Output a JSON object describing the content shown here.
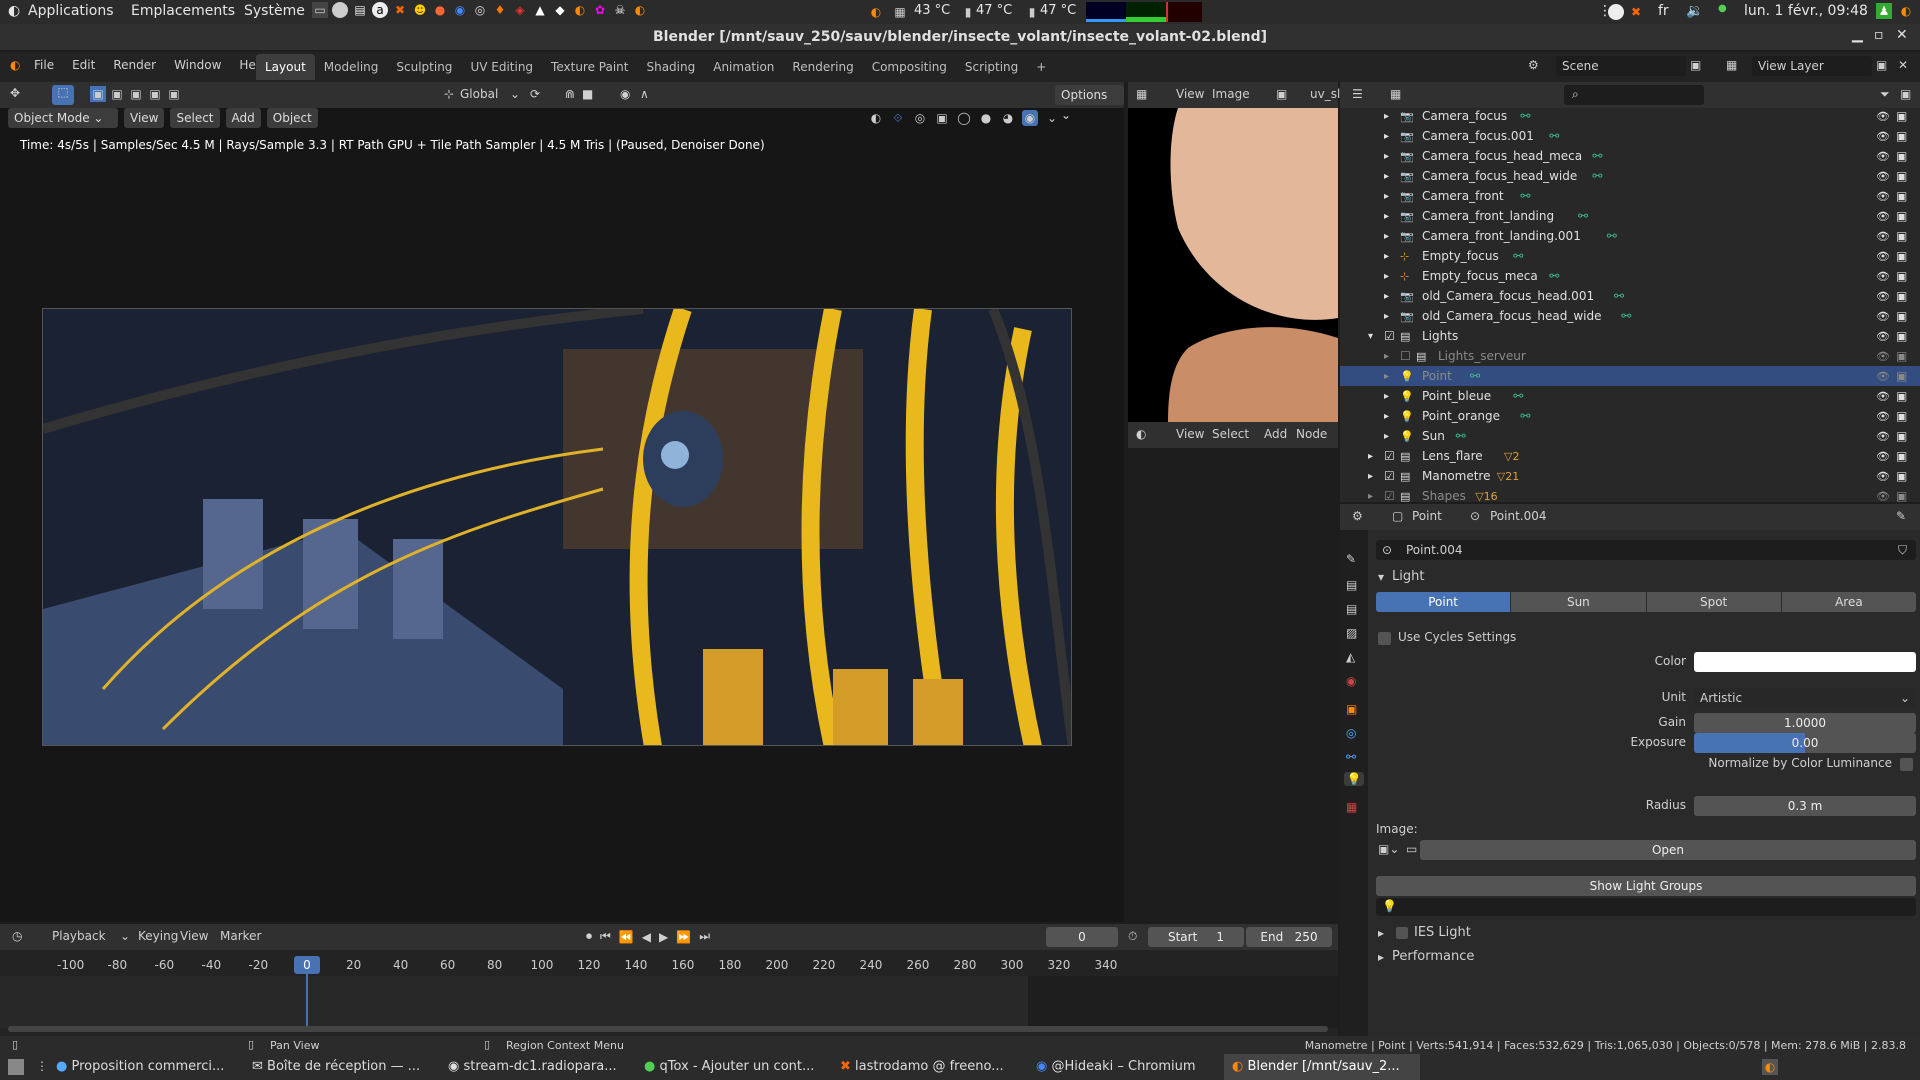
{
  "os_bar": {
    "apps": "Applications",
    "places": "Emplacements",
    "system": "Système",
    "temps": [
      "43 °C",
      "47 °C",
      "47 °C"
    ],
    "lang": "fr",
    "datetime": "lun. 1 févr., 09:48"
  },
  "window": {
    "title": "Blender [/mnt/sauv_250/sauv/blender/insecte_volant/insecte_volant-02.blend]"
  },
  "menu": [
    "File",
    "Edit",
    "Render",
    "Window",
    "Help"
  ],
  "workspaces": [
    "Layout",
    "Modeling",
    "Sculpting",
    "UV Editing",
    "Texture Paint",
    "Shading",
    "Animation",
    "Rendering",
    "Compositing",
    "Scripting"
  ],
  "scene": {
    "name": "Scene",
    "view_layer": "View Layer"
  },
  "viewport": {
    "transform": "Global",
    "options": "Options",
    "mode": "Object Mode",
    "menus": [
      "View",
      "Select",
      "Add",
      "Object"
    ],
    "status": "Time: 4s/5s | Samples/Sec 4.5 M | Rays/Sample 3.3 | RT Path GPU + Tile Path Sampler | 4.5 M Tris | (Paused, Denoiser Done)"
  },
  "image_editor": {
    "menus": [
      "View",
      "Image"
    ],
    "slot": "uv_sl"
  },
  "node_editor": {
    "menus": [
      "View",
      "Select",
      "Add",
      "Node"
    ]
  },
  "outliner": {
    "search_placeholder": "",
    "items": [
      {
        "label": "Camera_focus",
        "type": "camera",
        "indent": 1
      },
      {
        "label": "Camera_focus.001",
        "type": "camera",
        "indent": 1
      },
      {
        "label": "Camera_focus_head_meca",
        "type": "camera",
        "indent": 1
      },
      {
        "label": "Camera_focus_head_wide",
        "type": "camera",
        "indent": 1
      },
      {
        "label": "Camera_front",
        "type": "camera",
        "indent": 1
      },
      {
        "label": "Camera_front_landing",
        "type": "camera",
        "indent": 1
      },
      {
        "label": "Camera_front_landing.001",
        "type": "camera",
        "indent": 1
      },
      {
        "label": "Empty_focus",
        "type": "empty",
        "indent": 1
      },
      {
        "label": "Empty_focus_meca",
        "type": "empty",
        "indent": 1
      },
      {
        "label": "old_Camera_focus_head.001",
        "type": "camera",
        "indent": 1
      },
      {
        "label": "old_Camera_focus_head_wide",
        "type": "camera",
        "indent": 1
      },
      {
        "label": "Lights",
        "type": "collection",
        "indent": 0
      },
      {
        "label": "Lights_serveur",
        "type": "collection",
        "indent": 1
      },
      {
        "label": "Point",
        "type": "light",
        "indent": 1
      },
      {
        "label": "Point_bleue",
        "type": "light",
        "indent": 1
      },
      {
        "label": "Point_orange",
        "type": "light",
        "indent": 1
      },
      {
        "label": "Sun",
        "type": "light",
        "indent": 1
      },
      {
        "label": "Lens_flare",
        "type": "collection",
        "indent": 0
      },
      {
        "label": "Manometre",
        "type": "collection",
        "indent": 0
      },
      {
        "label": "Shapes",
        "type": "collection",
        "indent": 0
      }
    ],
    "badges": {
      "Lens_flare": "2",
      "Manometre": "21",
      "Shapes": "16"
    }
  },
  "properties": {
    "object": "Point",
    "data": "Point.004",
    "datablock": "Point.004",
    "panel": "Light",
    "types": [
      "Point",
      "Sun",
      "Spot",
      "Area"
    ],
    "use_cycles": "Use Cycles Settings",
    "color_label": "Color",
    "unit_label": "Unit",
    "unit_value": "Artistic",
    "gain_label": "Gain",
    "gain_value": "1.0000",
    "exposure_label": "Exposure",
    "exposure_value": "0.00",
    "normalize": "Normalize by Color Luminance",
    "radius_label": "Radius",
    "radius_value": "0.3 m",
    "image_label": "Image:",
    "open": "Open",
    "show_light_groups": "Show Light Groups",
    "ies": "IES Light",
    "performance": "Performance"
  },
  "timeline": {
    "menus": [
      "Playback",
      "Keying",
      "View",
      "Marker"
    ],
    "frame": "0",
    "start_label": "Start",
    "start": "1",
    "end_label": "End",
    "end": "250",
    "ticks": [
      "-100",
      "-80",
      "-60",
      "-40",
      "-20",
      "0",
      "20",
      "40",
      "60",
      "80",
      "100",
      "120",
      "140",
      "160",
      "180",
      "200",
      "220",
      "240",
      "260",
      "280",
      "300",
      "320",
      "340"
    ]
  },
  "statusbar": {
    "pan": "Pan View",
    "context": "Region Context Menu",
    "stats": "Manometre | Point | Verts:541,914 | Faces:532,629 | Tris:1,065,030 | Objects:0/578 | Mem: 278.6 MiB | 2.83.8"
  },
  "taskbar": [
    "Proposition commerci...",
    "Boîte de réception — ...",
    "stream-dc1.radiopara...",
    "qTox - Ajouter un cont...",
    "lastrodamo @ freeno...",
    "@Hideaki – Chromium",
    "Blender [/mnt/sauv_2..."
  ],
  "colors": {
    "accent": "#4772b3",
    "select": "#334d80",
    "render_bg": "#101010"
  }
}
